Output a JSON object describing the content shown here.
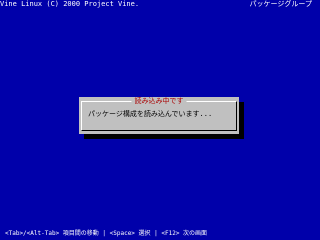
{
  "header": {
    "left_text": "Vine Linux (C) 2000 Project Vine.",
    "right_text": "パッケージグループ"
  },
  "dialog": {
    "title": "読み込み中です",
    "message": "パッケージ構成を読み込んでいます..."
  },
  "footer": {
    "help_text": "<Tab>/<Alt-Tab> 項目間の移動 | <Space> 選択 | <F12> 次の画面"
  }
}
